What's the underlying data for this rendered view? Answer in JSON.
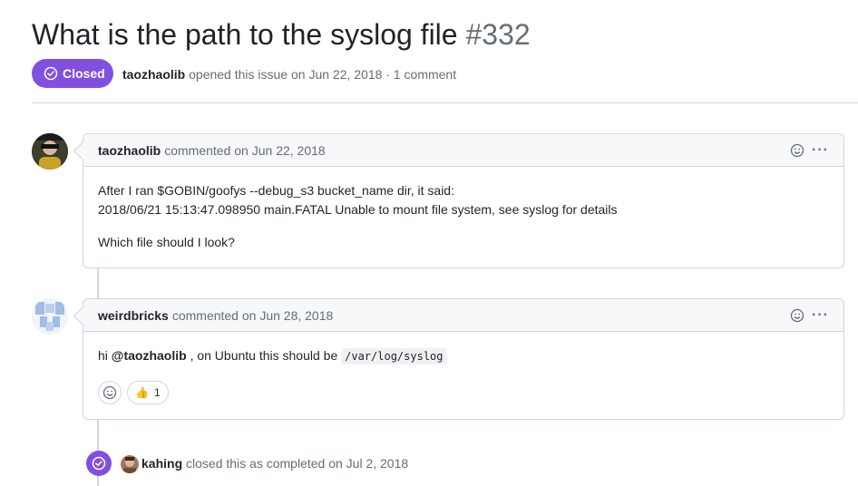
{
  "issue": {
    "title": "What is the path to the syslog file",
    "number": "#332",
    "state": "Closed",
    "author": "taozhaolib",
    "opened_text": "opened this issue on Jun 22, 2018",
    "separator": "·",
    "comment_count": "1 comment"
  },
  "comments": [
    {
      "author": "taozhaolib",
      "meta": "commented on Jun 22, 2018",
      "lines": [
        "After I ran $GOBIN/goofys --debug_s3 bucket_name dir, it said:",
        "2018/06/21 15:13:47.098950 main.FATAL Unable to mount file system, see syslog for details",
        "Which file should I look?"
      ],
      "avatar_icon": "user-avatar-photo"
    },
    {
      "author": "weirdbricks",
      "meta": "commented on Jun 28, 2018",
      "greeting": "hi",
      "mention": "@taozhaolib",
      "text_after": ", on Ubuntu this should be",
      "code": "/var/log/syslog",
      "avatar_icon": "identicon-avatar",
      "reactions": [
        {
          "emoji": "👍",
          "count": "1"
        }
      ]
    }
  ],
  "event": {
    "actor": "kahing",
    "text": "closed this as completed on Jul 2, 2018"
  },
  "colors": {
    "closed_purple": "#8250df",
    "border": "#d0d7de",
    "muted": "#656d76",
    "header_bg": "#f6f8fa"
  }
}
